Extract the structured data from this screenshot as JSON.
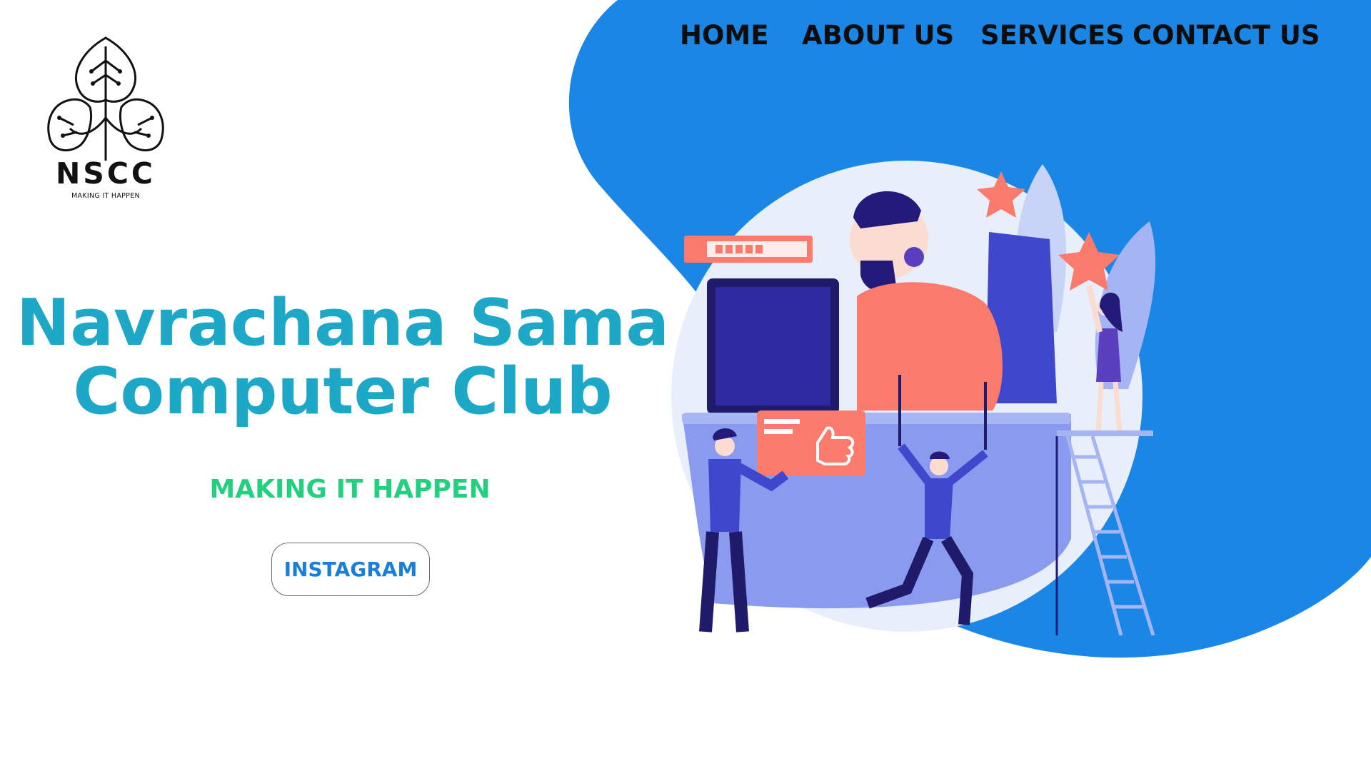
{
  "logo": {
    "icon": "circuit-tree-icon",
    "name": "NSCC",
    "tagline": "MAKING IT HAPPEN"
  },
  "nav": {
    "items": [
      {
        "label": "HOME"
      },
      {
        "label": "ABOUT US"
      },
      {
        "label": "SERVICES"
      },
      {
        "label": "CONTACT US"
      }
    ]
  },
  "hero": {
    "title_line1": "Navrachana Sama",
    "title_line2": "Computer Club",
    "tagline": "MAKING IT HAPPEN",
    "instagram_label": "INSTAGRAM"
  },
  "illustration": {
    "icon": "team-workspace-illustration"
  },
  "colors": {
    "blob": "#1a87e6",
    "title": "#1ea8c8",
    "tagline": "#23d07f",
    "button_text": "#1a7fd8",
    "coral": "#fa7b6c",
    "navy": "#2a1f8f",
    "desk": "#8a9bef"
  }
}
